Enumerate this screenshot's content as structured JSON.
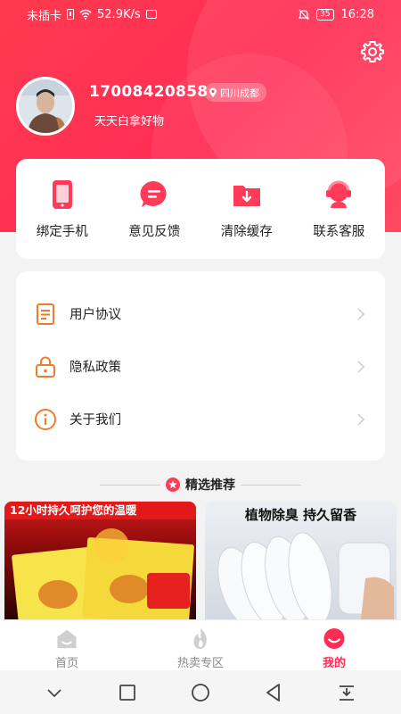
{
  "status_bar": {
    "carrier": "未插卡",
    "speed": "52.9K/s",
    "battery": "35",
    "time": "16:28"
  },
  "profile": {
    "phone": "17008420858",
    "location": "四川成都",
    "slogan": "天天白拿好物"
  },
  "tools": [
    {
      "label": "绑定手机",
      "icon": "phone-icon"
    },
    {
      "label": "意见反馈",
      "icon": "feedback-icon"
    },
    {
      "label": "清除缓存",
      "icon": "clear-cache-icon"
    },
    {
      "label": "联系客服",
      "icon": "customer-service-icon"
    }
  ],
  "menu": [
    {
      "label": "用户协议",
      "icon": "document-icon"
    },
    {
      "label": "隐私政策",
      "icon": "lock-icon"
    },
    {
      "label": "关于我们",
      "icon": "info-icon"
    }
  ],
  "recommend": {
    "title": "精选推荐",
    "products": [
      {
        "banner": "12小时持久呵护您的温暖"
      },
      {
        "banner": "植物除臭 持久留香"
      }
    ]
  },
  "tabbar": [
    {
      "label": "首页",
      "active": false
    },
    {
      "label": "热卖专区",
      "active": false
    },
    {
      "label": "我的",
      "active": true
    }
  ],
  "colors": {
    "accent": "#ff2d55",
    "icon_orange": "#f07b2a"
  }
}
